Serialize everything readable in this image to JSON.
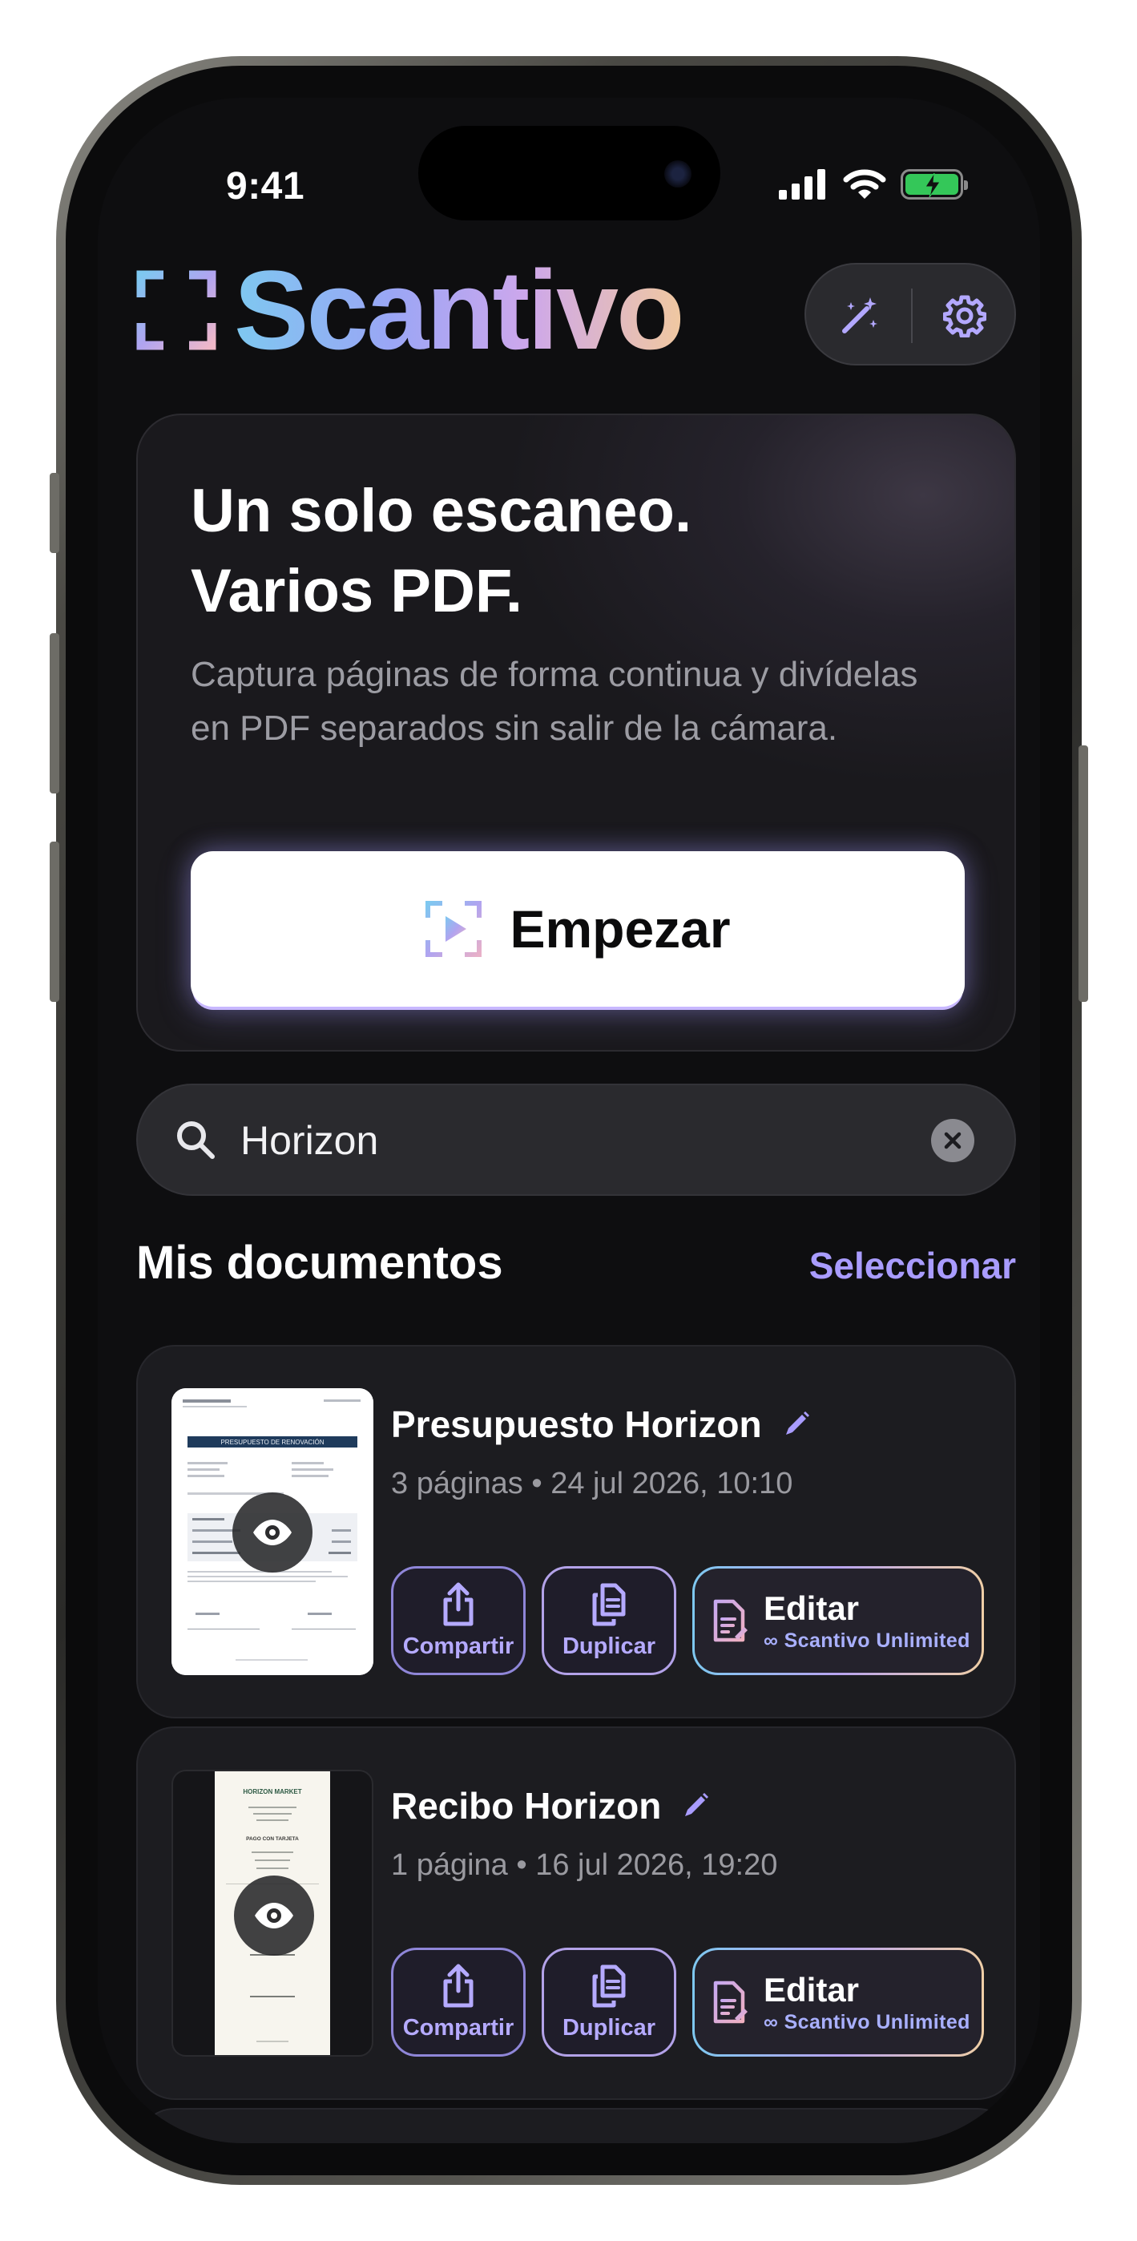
{
  "status_bar": {
    "time": "9:41"
  },
  "header": {
    "app_name": "Scantivo"
  },
  "hero": {
    "title_line1": "Un solo escaneo.",
    "title_line2": "Varios PDF.",
    "description": "Captura páginas de forma continua y divídelas en PDF separados sin salir de la cámara.",
    "start_label": "Empezar"
  },
  "search": {
    "value": "Horizon"
  },
  "documents_section": {
    "title": "Mis documentos",
    "select_label": "Seleccionar"
  },
  "documents": [
    {
      "title": "Presupuesto Horizon",
      "meta": "3 páginas • 24 jul 2026, 10:10",
      "share_label": "Compartir",
      "duplicate_label": "Duplicar",
      "edit_label": "Editar",
      "edit_sub": "∞ Scantivo Unlimited",
      "thumb": {
        "header": "PRESUPUESTO DE RENOVACIÓN"
      }
    },
    {
      "title": "Recibo Horizon",
      "meta": "1 página • 16 jul 2026, 19:20",
      "share_label": "Compartir",
      "duplicate_label": "Duplicar",
      "edit_label": "Editar",
      "edit_sub": "∞ Scantivo Unlimited",
      "thumb": {
        "header": "HORIZON MARKET",
        "line": "PAGO CON TARJETA"
      }
    }
  ],
  "colors": {
    "accent": "#a99cff",
    "background": "#0e0e10",
    "card": "#1c1c20",
    "battery": "#34c759"
  }
}
